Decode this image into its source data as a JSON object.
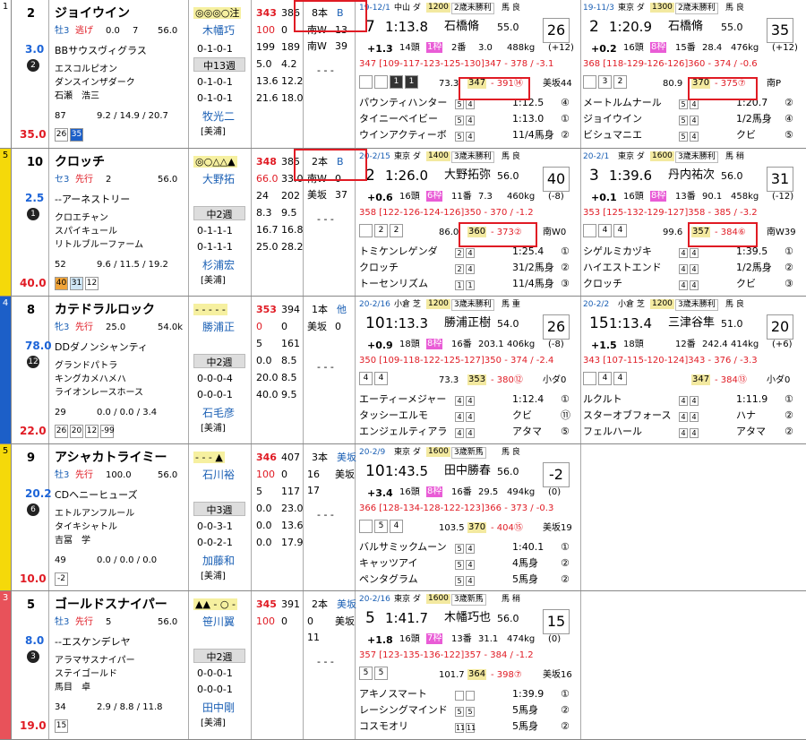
{
  "horses": [
    {
      "waku": "1",
      "waku_color": "#ffffff",
      "uma": "2",
      "name": "ジョイウイン",
      "odds": "3.0",
      "rank": "2",
      "win_odds": "35.0",
      "age": "牡3",
      "style": "逃げ",
      "style_val": "0.0",
      "weight_num": "7",
      "kin": "56.0",
      "sire": "BBサウスヴィグラス",
      "dam": "エスコルピオン",
      "damsire": "ダンスインザダーク",
      "owner": "石瀬　浩三",
      "marks": "◎◎◎○注",
      "jockey": "木幡巧",
      "jock_stats": "0-1-0-1",
      "train_label": "中13週",
      "t2": "0-1-0-1",
      "t3": "0-1-0-1",
      "trainer": "牧光二",
      "ba": "[美浦]",
      "s1": [
        "343",
        "386"
      ],
      "s2": [
        "100",
        "0"
      ],
      "s3": [
        "199",
        "189"
      ],
      "s4": [
        "5.0",
        "4.2"
      ],
      "s5": [
        "13.6",
        "12.2"
      ],
      "s6": [
        "21.6",
        "18.0"
      ],
      "bottom_l": "87",
      "bottom_vals": [
        "9.2",
        "/ 14.9",
        "/ 20.7"
      ],
      "cells": [
        "26",
        "35"
      ],
      "mid": [
        "8本",
        "B",
        "南W",
        "13",
        "南W",
        "39",
        "- - -"
      ],
      "r1": {
        "date": "19-12/1",
        "course": "中山 ダ",
        "dist": "1200",
        "cls": "2歳未勝利",
        "go": "馬 良",
        "pos": "7",
        "time": "1:13.8",
        "jockey": "石橋脩",
        "kin": "55.0",
        "ninki": "26",
        "diff": "+1.3",
        "heads": "14頭",
        "pl": "1枠",
        "num": "2番",
        "odds": "3.0",
        "bw": "488kg",
        "bwd": "(+12)",
        "laps": "347 [109-117-123-125-130]347 - 378 / -3.1",
        "cells": [
          "",
          "",
          "1",
          "1"
        ],
        "pace": "73.3",
        "f3a": "347",
        "f3b": "391⑭",
        "coach": "美坂44",
        "res": [
          [
            "パウンティハンター",
            "5",
            "4",
            "1:12.5",
            "④"
          ],
          [
            "タイニーベイビー",
            "5",
            "4",
            "1:13.0",
            "①"
          ],
          [
            "ウインアクティーボ",
            "5",
            "4",
            "11/4馬身",
            "②"
          ]
        ]
      },
      "r2": {
        "date": "19-11/3",
        "course": "東京 ダ",
        "dist": "1300",
        "cls": "2歳未勝利",
        "go": "馬 良",
        "pos": "2",
        "time": "1:20.9",
        "jockey": "石橋脩",
        "kin": "55.0",
        "ninki": "35",
        "diff": "+0.2",
        "heads": "16頭",
        "pl": "8枠",
        "num": "15番",
        "odds": "28.4",
        "bw": "476kg",
        "bwd": "(+12)",
        "laps": "368 [118-129-126-126]360 - 374 / -0.6",
        "cells": [
          "",
          "3",
          "2"
        ],
        "pace": "80.9",
        "f3a": "370",
        "f3b": "375⑦",
        "coach": "南P",
        "res": [
          [
            "メートルムナール",
            "5",
            "4",
            "1:20.7",
            "②"
          ],
          [
            "ジョイウイン",
            "5",
            "4",
            "1/2馬身",
            "④"
          ],
          [
            "ビシュマニエ",
            "5",
            "4",
            "クビ",
            "⑤"
          ]
        ]
      }
    },
    {
      "waku": "5",
      "waku_color": "#f5d90a",
      "uma": "10",
      "name": "クロッチ",
      "odds": "2.5",
      "rank": "1",
      "win_odds": "40.0",
      "age": "セ3",
      "style": "先行",
      "style_val": "2",
      "weight_num": "",
      "kin": "56.0",
      "sire": "--アーネストリー",
      "dam": "クロエチャン",
      "damsire": "スパイキュール",
      "owner": "リトルブルーファーム",
      "marks": "◎○△△▲",
      "jockey": "大野拓",
      "jock_stats": "",
      "train_label": "中2週",
      "t2": "0-1-1-1",
      "t3": "0-1-1-1",
      "trainer": "杉浦宏",
      "ba": "[美浦]",
      "s1": [
        "348",
        "385"
      ],
      "s2": [
        "66.0",
        "33.0"
      ],
      "s3": [
        "24",
        "202"
      ],
      "s4": [
        "8.3",
        "9.5"
      ],
      "s5": [
        "16.7",
        "16.8"
      ],
      "s6": [
        "25.0",
        "28.2"
      ],
      "bottom_l": "52",
      "bottom_vals": [
        "9.6",
        "/ 11.5",
        "/ 19.2"
      ],
      "cells": [
        "40",
        "31",
        "12"
      ],
      "mid": [
        "2本",
        "B",
        "南W",
        "0",
        "美坂",
        "37",
        "- - -"
      ],
      "r1": {
        "date": "20-2/15",
        "course": "東京 ダ",
        "dist": "1400",
        "cls": "3歳未勝利",
        "go": "馬 良",
        "pos": "2",
        "time": "1:26.0",
        "jockey": "大野拓弥",
        "kin": "56.0",
        "ninki": "40",
        "diff": "+0.6",
        "heads": "16頭",
        "pl": "6枠",
        "num": "11番",
        "odds": "7.3",
        "bw": "460kg",
        "bwd": "(-8)",
        "laps": "358 [122-126-124-126]350 - 370 / -1.2",
        "cells": [
          "",
          "2",
          "2"
        ],
        "pace": "86.0",
        "f3a": "360",
        "f3b": "373②",
        "coach": "南W0",
        "res": [
          [
            "トミケンレゲンダ",
            "2",
            "4",
            "1:25.4",
            "①"
          ],
          [
            "クロッチ",
            "2",
            "4",
            "31/2馬身",
            "②"
          ],
          [
            "トーセンリズム",
            "1",
            "1",
            "11/4馬身",
            "③"
          ]
        ]
      },
      "r2": {
        "date": "20-2/1",
        "course": "東京 ダ",
        "dist": "1600",
        "cls": "3歳未勝利",
        "go": "馬 稍",
        "pos": "3",
        "time": "1:39.6",
        "jockey": "丹内祐次",
        "kin": "56.0",
        "ninki": "31",
        "diff": "+0.1",
        "heads": "16頭",
        "pl": "8枠",
        "num": "13番",
        "odds": "90.1",
        "bw": "458kg",
        "bwd": "(-12)",
        "laps": "353 [125-132-129-127]358 - 385 / -3.2",
        "cells": [
          "",
          "4",
          "4"
        ],
        "pace": "99.6",
        "f3a": "357",
        "f3b": "384⑥",
        "coach": "南W39",
        "res": [
          [
            "シゲルミカヅキ",
            "4",
            "4",
            "1:39.5",
            "①"
          ],
          [
            "ハイエストエンド",
            "4",
            "4",
            "1/2馬身",
            "②"
          ],
          [
            "クロッチ",
            "4",
            "4",
            "クビ",
            "③"
          ]
        ]
      }
    },
    {
      "waku": "4",
      "waku_color": "#1c5fc8",
      "uma": "8",
      "name": "カテドラルロック",
      "odds": "78.0",
      "rank": "12",
      "win_odds": "22.0",
      "age": "牝3",
      "style": "先行",
      "style_val": "25.0",
      "weight_num": "",
      "kin": "54.0k",
      "sire": "DDダノンシャンティ",
      "dam": "グランドパトラ",
      "damsire": "キングカメハメハ",
      "owner": "ライオンレースホース",
      "marks": "- - - - -",
      "jockey": "勝浦正",
      "jock_stats": "",
      "train_label": "中2週",
      "t2": "0-0-0-4",
      "t3": "0-0-0-1",
      "trainer": "石毛彦",
      "ba": "[美浦]",
      "s1": [
        "353",
        "394"
      ],
      "s2": [
        "0",
        "0"
      ],
      "s3": [
        "5",
        "161"
      ],
      "s4": [
        "0.0",
        "8.5"
      ],
      "s5": [
        "20.0",
        "8.5"
      ],
      "s6": [
        "40.0",
        "9.5"
      ],
      "bottom_l": "29",
      "bottom_vals": [
        "0.0",
        "/ 0.0",
        "/ 3.4"
      ],
      "cells": [
        "26",
        "20",
        "12",
        "-99"
      ],
      "mid": [
        "1本",
        "他",
        "美坂",
        "0",
        "",
        "",
        "- - -"
      ],
      "r1": {
        "date": "20-2/16",
        "course": "小倉 芝",
        "dist": "1200",
        "cls": "3歳未勝利",
        "go": "馬 重",
        "pos": "10",
        "time": "1:13.3",
        "jockey": "勝浦正樹",
        "kin": "54.0",
        "ninki": "26",
        "diff": "+0.9",
        "heads": "18頭",
        "pl": "8枠",
        "num": "16番",
        "odds": "203.1",
        "bw": "406kg",
        "bwd": "(-8)",
        "laps": "350 [109-118-122-125-127]350 - 374 / -2.4",
        "cells": [
          "4",
          "4"
        ],
        "pace": "73.3",
        "f3a": "353",
        "f3b": "380⑫",
        "coach": "小ダ0",
        "res": [
          [
            "エーティーメジャー",
            "4",
            "4",
            "1:12.4",
            "①"
          ],
          [
            "タッシーエルモ",
            "4",
            "4",
            "クビ",
            "⑪"
          ],
          [
            "エンジェルティアラ",
            "4",
            "4",
            "アタマ",
            "⑤"
          ]
        ]
      },
      "r2": {
        "date": "20-2/2",
        "course": "小倉 芝",
        "dist": "1200",
        "cls": "3歳未勝利",
        "go": "馬 良",
        "pos": "15",
        "time": "1:13.4",
        "jockey": "三津谷隼",
        "kin": "51.0",
        "ninki": "20",
        "diff": "+1.5",
        "heads": "18頭",
        "pl": "",
        "num": "12番",
        "odds": "242.4",
        "bw": "414kg",
        "bwd": "(+6)",
        "laps": "343 [107-115-120-124]343 - 376 / -3.3",
        "cells": [
          "",
          "4",
          "4"
        ],
        "pace": "",
        "f3a": "347",
        "f3b": "384⑬",
        "coach": "小ダ0",
        "res": [
          [
            "ルクルト",
            "4",
            "4",
            "1:11.9",
            "①"
          ],
          [
            "スターオブフォース",
            "4",
            "4",
            "ハナ",
            "②"
          ],
          [
            "フェルハール",
            "4",
            "4",
            "アタマ",
            "②"
          ]
        ]
      }
    },
    {
      "waku": "5",
      "waku_color": "#f5d90a",
      "uma": "9",
      "name": "アシャカトライミー",
      "odds": "20.2",
      "rank": "6",
      "win_odds": "10.0",
      "age": "牡3",
      "style": "先行",
      "style_val": "100.0",
      "weight_num": "",
      "kin": "56.0",
      "sire": "CDヘニーヒューズ",
      "dam": "エトルアンフルール",
      "damsire": "タイキシャトル",
      "owner": "吉冨　学",
      "marks": "- - - ▲",
      "jockey": "石川裕",
      "jock_stats": "",
      "train_label": "中3週",
      "t2": "0-0-3-1",
      "t3": "0-0-2-1",
      "trainer": "加藤和",
      "ba": "[美浦]",
      "s1": [
        "346",
        "407"
      ],
      "s2": [
        "100",
        "0"
      ],
      "s3": [
        "5",
        "117"
      ],
      "s4": [
        "0.0",
        "23.0"
      ],
      "s5": [
        "0.0",
        "13.6"
      ],
      "s6": [
        "0.0",
        "17.9"
      ],
      "bottom_l": "49",
      "bottom_vals": [
        "0.0",
        "/ 0.0",
        "/ 0.0"
      ],
      "cells": [
        "-2"
      ],
      "mid": [
        "3本",
        "美坂",
        "16",
        "美坂",
        "17",
        "",
        "- - -"
      ],
      "r1": {
        "date": "20-2/9",
        "course": "東京 ダ",
        "dist": "1600",
        "cls": "3歳新馬",
        "go": "馬 良",
        "pos": "10",
        "time": "1:43.5",
        "jockey": "田中勝春",
        "kin": "56.0",
        "ninki": "-2",
        "diff": "+3.4",
        "heads": "16頭",
        "pl": "8枠",
        "num": "16番",
        "odds": "29.5",
        "bw": "494kg",
        "bwd": "(0)",
        "laps": "366 [128-134-128-122-123]366 - 373 / -0.3",
        "cells": [
          "",
          "5",
          "4"
        ],
        "pace": "103.5",
        "f3a": "370",
        "f3b": "404⑮",
        "coach": "美坂19",
        "res": [
          [
            "バルサミックムーン",
            "5",
            "4",
            "1:40.1",
            "①"
          ],
          [
            "キャッツアイ",
            "5",
            "4",
            "4馬身",
            "②"
          ],
          [
            "ペンタグラム",
            "5",
            "4",
            "5馬身",
            "②"
          ]
        ]
      },
      "r2": null
    },
    {
      "waku": "3",
      "waku_color": "#e8525a",
      "uma": "5",
      "name": "ゴールドスナイパー",
      "odds": "8.0",
      "rank": "3",
      "win_odds": "19.0",
      "age": "牡3",
      "style": "先行",
      "style_val": "5",
      "weight_num": "",
      "kin": "56.0",
      "sire": "--エスケンデレヤ",
      "dam": "アラマサスナイパー",
      "damsire": "ステイゴールド",
      "owner": "馬目　卓",
      "marks": "▲▲ - ○ -",
      "jockey": "笹川翼",
      "jock_stats": "",
      "train_label": "中2週",
      "t2": "0-0-0-1",
      "t3": "0-0-0-1",
      "trainer": "田中剛",
      "ba": "[美浦]",
      "s1": [
        "345",
        "391"
      ],
      "s2": [
        "100",
        "0"
      ],
      "s3": [
        "",
        ""
      ],
      "s4": [
        "",
        ""
      ],
      "s5": [
        "",
        ""
      ],
      "s6": [
        "",
        ""
      ],
      "bottom_l": "34",
      "bottom_vals": [
        "2.9",
        "/ 8.8",
        "/ 11.8"
      ],
      "cells": [
        "15"
      ],
      "mid": [
        "2本",
        "美坂",
        "0",
        "美坂",
        "11",
        "",
        "- - -"
      ],
      "r1": {
        "date": "20-2/16",
        "course": "東京 ダ",
        "dist": "1600",
        "cls": "3歳新馬",
        "go": "馬 稍",
        "pos": "5",
        "time": "1:41.7",
        "jockey": "木幡巧也",
        "kin": "56.0",
        "ninki": "15",
        "diff": "+1.8",
        "heads": "16頭",
        "pl": "7枠",
        "num": "13番",
        "odds": "31.1",
        "bw": "474kg",
        "bwd": "(0)",
        "laps": "357 [123-135-136-122]357 - 384 / -1.2",
        "cells": [
          "5",
          "5"
        ],
        "pace": "101.7",
        "f3a": "364",
        "f3b": "398⑦",
        "coach": "美坂16",
        "res": [
          [
            "アキノスマート",
            "",
            "",
            "1:39.9",
            "①"
          ],
          [
            "レーシングマインド",
            "5",
            "5",
            "5馬身",
            "②"
          ],
          [
            "コスモオリ",
            "11",
            "11",
            "5馬身",
            "②"
          ]
        ]
      },
      "r2": null
    }
  ]
}
